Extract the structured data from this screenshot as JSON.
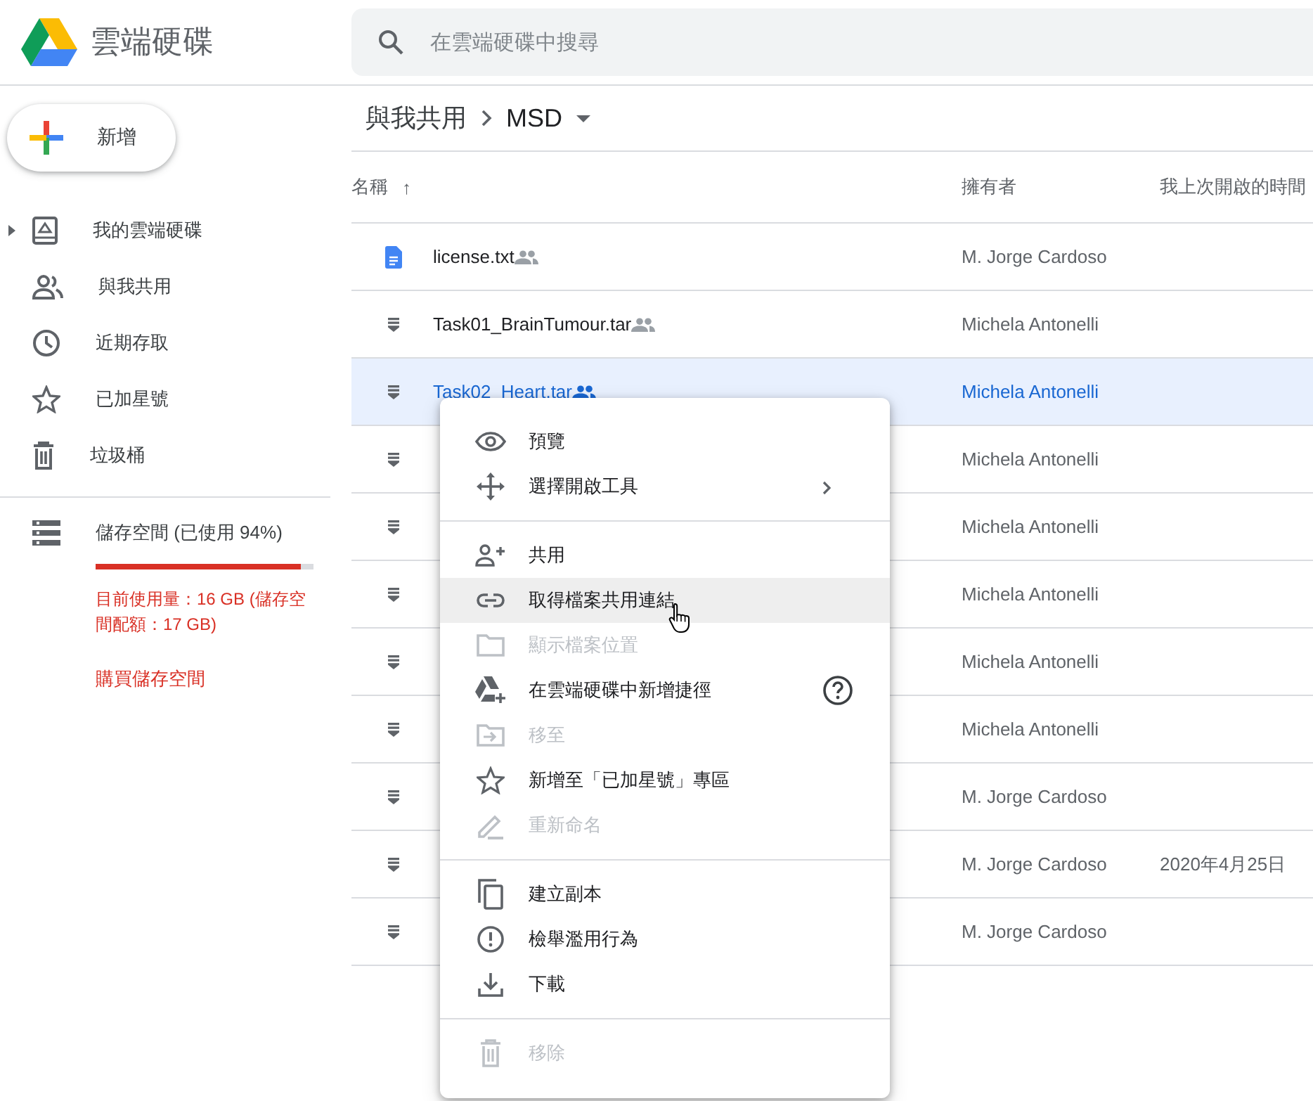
{
  "app": {
    "title": "雲端硬碟"
  },
  "search": {
    "placeholder": "在雲端硬碟中搜尋"
  },
  "new_button": {
    "label": "新增"
  },
  "sidebar": {
    "items": [
      {
        "label": "我的雲端硬碟",
        "expandable": true,
        "selected": false
      },
      {
        "label": "與我共用",
        "selected": false
      },
      {
        "label": "近期存取",
        "selected": false
      },
      {
        "label": "已加星號",
        "selected": false
      },
      {
        "label": "垃圾桶",
        "selected": false
      }
    ]
  },
  "storage": {
    "label": "儲存空間 (已使用 94%)",
    "level": 0.94,
    "usage": "目前使用量：16 GB (儲存空間配額：17 GB)",
    "buy_link": "購買儲存空間"
  },
  "breadcrumb": {
    "parent": "與我共用",
    "current": "MSD"
  },
  "table": {
    "columns": [
      "名稱",
      "擁有者",
      "我上次開啟的時間"
    ],
    "sort_arrow": "↑",
    "rows": [
      {
        "kind": "document",
        "name": "license.txt",
        "shared": true,
        "owner": "M. Jorge Cardoso",
        "selected": false
      },
      {
        "kind": "archive",
        "name": "Task01_BrainTumour.tar",
        "shared": true,
        "owner": "Michela Antonelli",
        "selected": false
      },
      {
        "kind": "archive",
        "name": "Task02_Heart.tar",
        "shared": true,
        "owner": "Michela Antonelli",
        "selected": true
      },
      {
        "kind": "archive",
        "owner": "Michela Antonelli",
        "selected": false
      },
      {
        "kind": "archive",
        "owner": "Michela Antonelli",
        "selected": false
      },
      {
        "kind": "archive",
        "owner": "Michela Antonelli",
        "selected": false
      },
      {
        "kind": "archive",
        "owner": "Michela Antonelli",
        "selected": false
      },
      {
        "kind": "archive",
        "owner": "Michela Antonelli",
        "selected": false
      },
      {
        "kind": "archive",
        "owner": "M. Jorge Cardoso",
        "selected": false
      },
      {
        "kind": "archive",
        "owner": "M. Jorge Cardoso",
        "last_opened": "2020年4月25日",
        "selected": false
      },
      {
        "kind": "archive",
        "owner": "M. Jorge Cardoso",
        "selected": false
      }
    ]
  },
  "context_menu": {
    "groups": [
      [
        {
          "label": "預覽",
          "disabled": false,
          "highlighted": false
        },
        {
          "label": "選擇開啟工具",
          "disabled": false,
          "highlighted": false,
          "submenu": true
        }
      ],
      [
        {
          "label": "共用",
          "disabled": false,
          "highlighted": false
        },
        {
          "label": "取得檔案共用連結",
          "disabled": false,
          "highlighted": true
        },
        {
          "label": "顯示檔案位置",
          "disabled": true,
          "highlighted": false
        },
        {
          "label": "在雲端硬碟中新增捷徑",
          "disabled": false,
          "highlighted": false,
          "help": true
        },
        {
          "label": "移至",
          "disabled": true,
          "highlighted": false
        },
        {
          "label": "新增至「已加星號」專區",
          "disabled": false,
          "highlighted": false
        },
        {
          "label": "重新命名",
          "disabled": true,
          "highlighted": false
        }
      ],
      [
        {
          "label": "建立副本",
          "disabled": false,
          "highlighted": false
        },
        {
          "label": "檢舉濫用行為",
          "disabled": false,
          "highlighted": false
        },
        {
          "label": "下載",
          "disabled": false,
          "highlighted": false
        }
      ],
      [
        {
          "label": "移除",
          "disabled": true,
          "highlighted": false
        }
      ]
    ]
  }
}
